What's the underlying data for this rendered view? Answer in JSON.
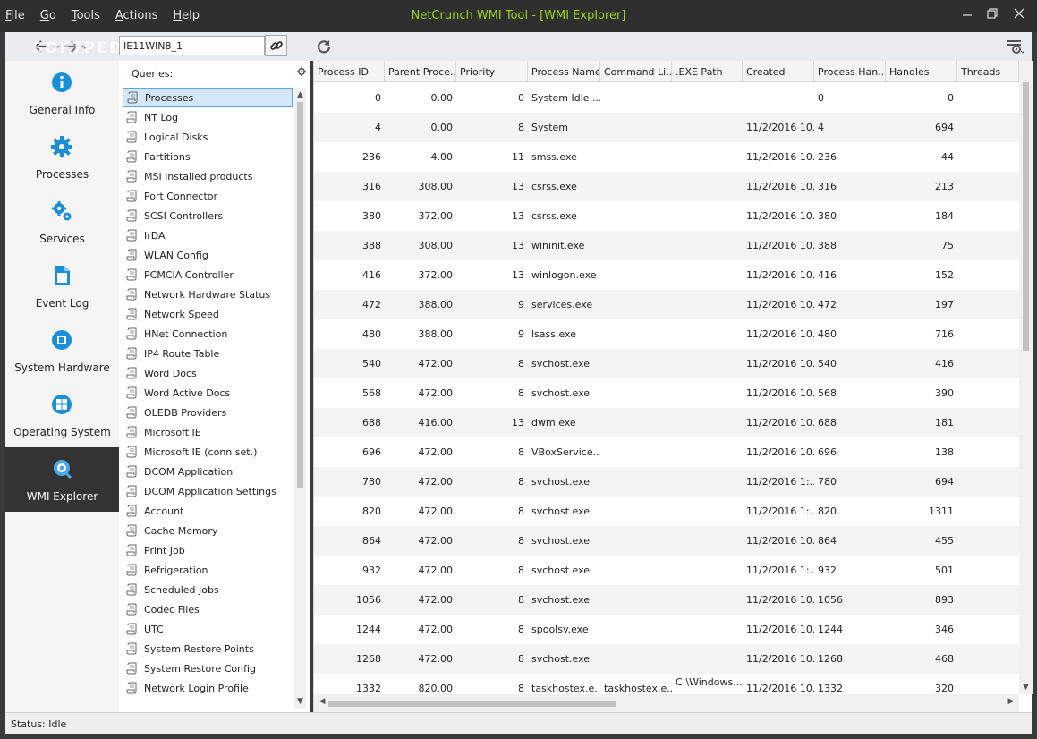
{
  "menu": [
    {
      "key": "F",
      "rest": "ile"
    },
    {
      "key": "G",
      "rest": "o"
    },
    {
      "key": "T",
      "rest": "ools"
    },
    {
      "key": "A",
      "rest": "ctions"
    },
    {
      "key": "H",
      "rest": "elp"
    }
  ],
  "window": {
    "title": "NetCrunch WMI Tool - [WMI Explorer]",
    "title_color": "#9ed420"
  },
  "toolbar": {
    "host_value": "IE11WIN8_1",
    "watermark": "SOFTPEDIA"
  },
  "sidebar": {
    "items": [
      {
        "label": "General Info",
        "icon": "info-icon"
      },
      {
        "label": "Processes",
        "icon": "gear-icon"
      },
      {
        "label": "Services",
        "icon": "gears-icon"
      },
      {
        "label": "Event Log",
        "icon": "document-icon"
      },
      {
        "label": "System Hardware",
        "icon": "chip-icon"
      },
      {
        "label": "Operating System",
        "icon": "windows-icon"
      },
      {
        "label": "WMI Explorer",
        "icon": "magnifier-gear-icon",
        "active": true
      }
    ],
    "accent": "#1a8fd8"
  },
  "queries": {
    "header": "Queries:",
    "selected": "Processes",
    "items": [
      "Processes",
      "NT Log",
      "Logical Disks",
      "Partitions",
      "MSI installed products",
      "Port Connector",
      "SCSI Controllers",
      "IrDA",
      "WLAN Config",
      "PCMCIA Controller",
      "Network Hardware Status",
      "Network Speed",
      "HNet Connection",
      "IP4 Route Table",
      "Word Docs",
      "Word Active Docs",
      "OLEDB Providers",
      "Microsoft IE",
      "Microsoft IE (conn set.)",
      "DCOM Application",
      "DCOM Application Settings",
      "Account",
      "Cache Memory",
      "Print Job",
      "Refrigeration",
      "Scheduled Jobs",
      "Codec Files",
      "UTC",
      "System Restore Points",
      "System Restore Config",
      "Network Login Profile"
    ]
  },
  "grid": {
    "columns": [
      "Process ID",
      "Parent Proce...",
      "Priority",
      "Process Name",
      "Command Li...",
      ".EXE Path",
      "Created",
      "Process Han...",
      "Handles",
      "Threads"
    ],
    "rows": [
      [
        "0",
        "0.00",
        "0",
        "System Idle ...",
        "",
        "",
        "",
        "0",
        "0",
        ""
      ],
      [
        "4",
        "0.00",
        "8",
        "System",
        "",
        "",
        "11/2/2016 10...",
        "4",
        "694",
        ""
      ],
      [
        "236",
        "4.00",
        "11",
        "smss.exe",
        "",
        "",
        "11/2/2016 10...",
        "236",
        "44",
        ""
      ],
      [
        "316",
        "308.00",
        "13",
        "csrss.exe",
        "",
        "",
        "11/2/2016 10...",
        "316",
        "213",
        ""
      ],
      [
        "380",
        "372.00",
        "13",
        "csrss.exe",
        "",
        "",
        "11/2/2016 10...",
        "380",
        "184",
        ""
      ],
      [
        "388",
        "308.00",
        "13",
        "wininit.exe",
        "",
        "",
        "11/2/2016 10...",
        "388",
        "75",
        ""
      ],
      [
        "416",
        "372.00",
        "13",
        "winlogon.exe",
        "",
        "",
        "11/2/2016 10...",
        "416",
        "152",
        ""
      ],
      [
        "472",
        "388.00",
        "9",
        "services.exe",
        "",
        "",
        "11/2/2016 10...",
        "472",
        "197",
        ""
      ],
      [
        "480",
        "388.00",
        "9",
        "lsass.exe",
        "",
        "",
        "11/2/2016 10...",
        "480",
        "716",
        ""
      ],
      [
        "540",
        "472.00",
        "8",
        "svchost.exe",
        "",
        "",
        "11/2/2016 10...",
        "540",
        "416",
        ""
      ],
      [
        "568",
        "472.00",
        "8",
        "svchost.exe",
        "",
        "",
        "11/2/2016 10...",
        "568",
        "390",
        ""
      ],
      [
        "688",
        "416.00",
        "13",
        "dwm.exe",
        "",
        "",
        "11/2/2016 10...",
        "688",
        "181",
        ""
      ],
      [
        "696",
        "472.00",
        "8",
        "VBoxService....",
        "",
        "",
        "11/2/2016 10...",
        "696",
        "138",
        ""
      ],
      [
        "780",
        "472.00",
        "8",
        "svchost.exe",
        "",
        "",
        "11/2/2016 1:...",
        "780",
        "694",
        ""
      ],
      [
        "820",
        "472.00",
        "8",
        "svchost.exe",
        "",
        "",
        "11/2/2016 1:...",
        "820",
        "1311",
        ""
      ],
      [
        "864",
        "472.00",
        "8",
        "svchost.exe",
        "",
        "",
        "11/2/2016 10...",
        "864",
        "455",
        ""
      ],
      [
        "932",
        "472.00",
        "8",
        "svchost.exe",
        "",
        "",
        "11/2/2016 1:...",
        "932",
        "501",
        ""
      ],
      [
        "1056",
        "472.00",
        "8",
        "svchost.exe",
        "",
        "",
        "11/2/2016 10...",
        "1056",
        "893",
        ""
      ],
      [
        "1244",
        "472.00",
        "8",
        "spoolsv.exe",
        "",
        "",
        "11/2/2016 10...",
        "1244",
        "346",
        ""
      ],
      [
        "1268",
        "472.00",
        "8",
        "svchost.exe",
        "",
        "",
        "11/2/2016 10...",
        "1268",
        "468",
        ""
      ],
      [
        "1332",
        "820.00",
        "8",
        "taskhostex.e...",
        "taskhostex.e...",
        "C:\\Windows...",
        "11/2/2016 10...",
        "1332",
        "320",
        ""
      ]
    ]
  },
  "status": {
    "text": "Status: Idle"
  }
}
